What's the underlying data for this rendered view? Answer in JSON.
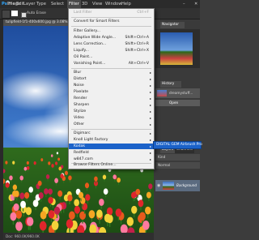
{
  "menubar": {
    "items": [
      "Ps",
      "File",
      "Edit",
      "Image",
      "Layer",
      "Type",
      "Select",
      "Filter",
      "3D",
      "View",
      "Window",
      "Help"
    ]
  },
  "options": {
    "auto_erase_label": "Auto Erase"
  },
  "document": {
    "tab_title": "tulipfield-1f1-400x600.jpg @ 3.08% (RGB/8)",
    "status_text": "Doc: 960.0K/960.0K"
  },
  "filter_menu": {
    "last_filter": "Last Filter",
    "last_filter_shortcut": "Ctrl+F",
    "convert_smart": "Convert for Smart Filters",
    "gallery": "Filter Gallery...",
    "adaptive_wide": "Adaptive Wide Angle...",
    "adaptive_wide_sc": "Shift+Ctrl+A",
    "lens_correction": "Lens Correction...",
    "lens_correction_sc": "Shift+Ctrl+R",
    "liquify": "Liquify...",
    "liquify_sc": "Shift+Ctrl+X",
    "oil_paint": "Oil Paint...",
    "vanishing_point": "Vanishing Point...",
    "vanishing_point_sc": "Alt+Ctrl+V",
    "blur": "Blur",
    "distort": "Distort",
    "noise": "Noise",
    "pixelate": "Pixelate",
    "render": "Render",
    "sharpen": "Sharpen",
    "stylize": "Stylize",
    "video": "Video",
    "other": "Other",
    "digimarc": "Digimarc",
    "knoll": "Knoll Light Factory",
    "kodak": "Kodak",
    "redfield": "Redfield",
    "w847": "w847.com",
    "browse": "Browse Filters Online..."
  },
  "submenu": {
    "label": "DIGITAL GEM Airbrush Pro"
  },
  "panels": {
    "navigator_tab": "Navigator",
    "histogram_tab": "History",
    "history_item": "dreamystuff...",
    "open_item": "Open",
    "layers_tab": "Layers",
    "channels_tab": "Channels",
    "paths_tab": "Paths",
    "kind_label": "Kind",
    "normal_label": "Normal",
    "layer_name": "Background"
  },
  "colors": {
    "menu_bg": "#f0f0f0",
    "highlight": "#1b62c9",
    "chrome": "#2b2b2b",
    "panel": "#3a3a3a"
  }
}
